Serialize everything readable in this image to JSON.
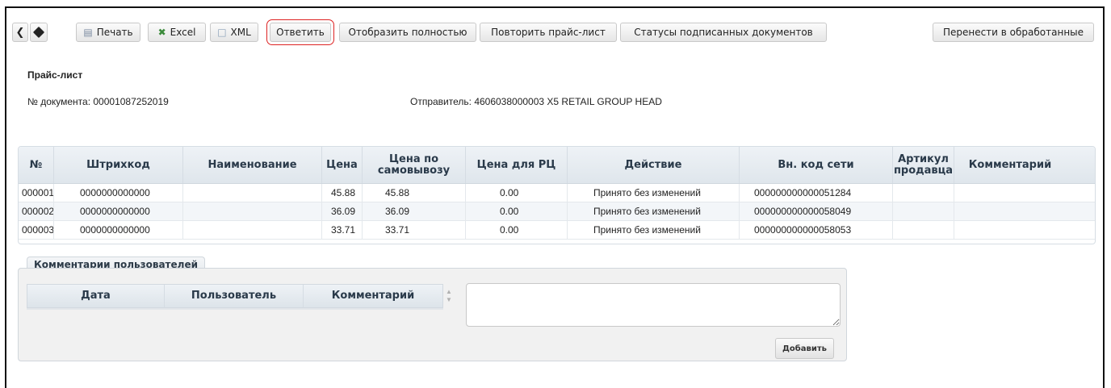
{
  "toolbar": {
    "back_icon": "chevron-left-icon",
    "tag_icon": "tag-icon",
    "print_label": "Печать",
    "excel_label": "Excel",
    "xml_label": "XML",
    "reply_label": "Ответить",
    "show_full_label": "Отобразить полностью",
    "repeat_pricelist_label": "Повторить прайс-лист",
    "signed_statuses_label": "Статусы подписанных документов",
    "move_processed_label": "Перенести в обработанные"
  },
  "document": {
    "title": "Прайс-лист",
    "number": "№ документа: 00001087252019",
    "sender": "Отправитель: 4606038000003 X5 RETAIL GROUP HEAD"
  },
  "table": {
    "headers": [
      "№",
      "Штрихкод",
      "Наименование",
      "Цена",
      "Цена по самовывозу",
      "Цена для РЦ",
      "Действие",
      "Вн. код сети",
      "Артикул продавца",
      "Комментарий"
    ],
    "rows": [
      [
        "000001",
        "0000000000000",
        "",
        "45.88",
        "45.88",
        "0.00",
        "Принято без изменений",
        "000000000000051284",
        "",
        ""
      ],
      [
        "000002",
        "0000000000000",
        "",
        "36.09",
        "36.09",
        "0.00",
        "Принято без изменений",
        "000000000000058049",
        "",
        ""
      ],
      [
        "000003",
        "0000000000000",
        "",
        "33.71",
        "33.71",
        "0.00",
        "Принято без изменений",
        "000000000000058053",
        "",
        ""
      ]
    ]
  },
  "comments": {
    "panel_title": "Комментарии пользователей",
    "headers": [
      "Дата",
      "Пользователь",
      "Комментарий"
    ],
    "input_value": "",
    "add_label": "Добавить"
  }
}
